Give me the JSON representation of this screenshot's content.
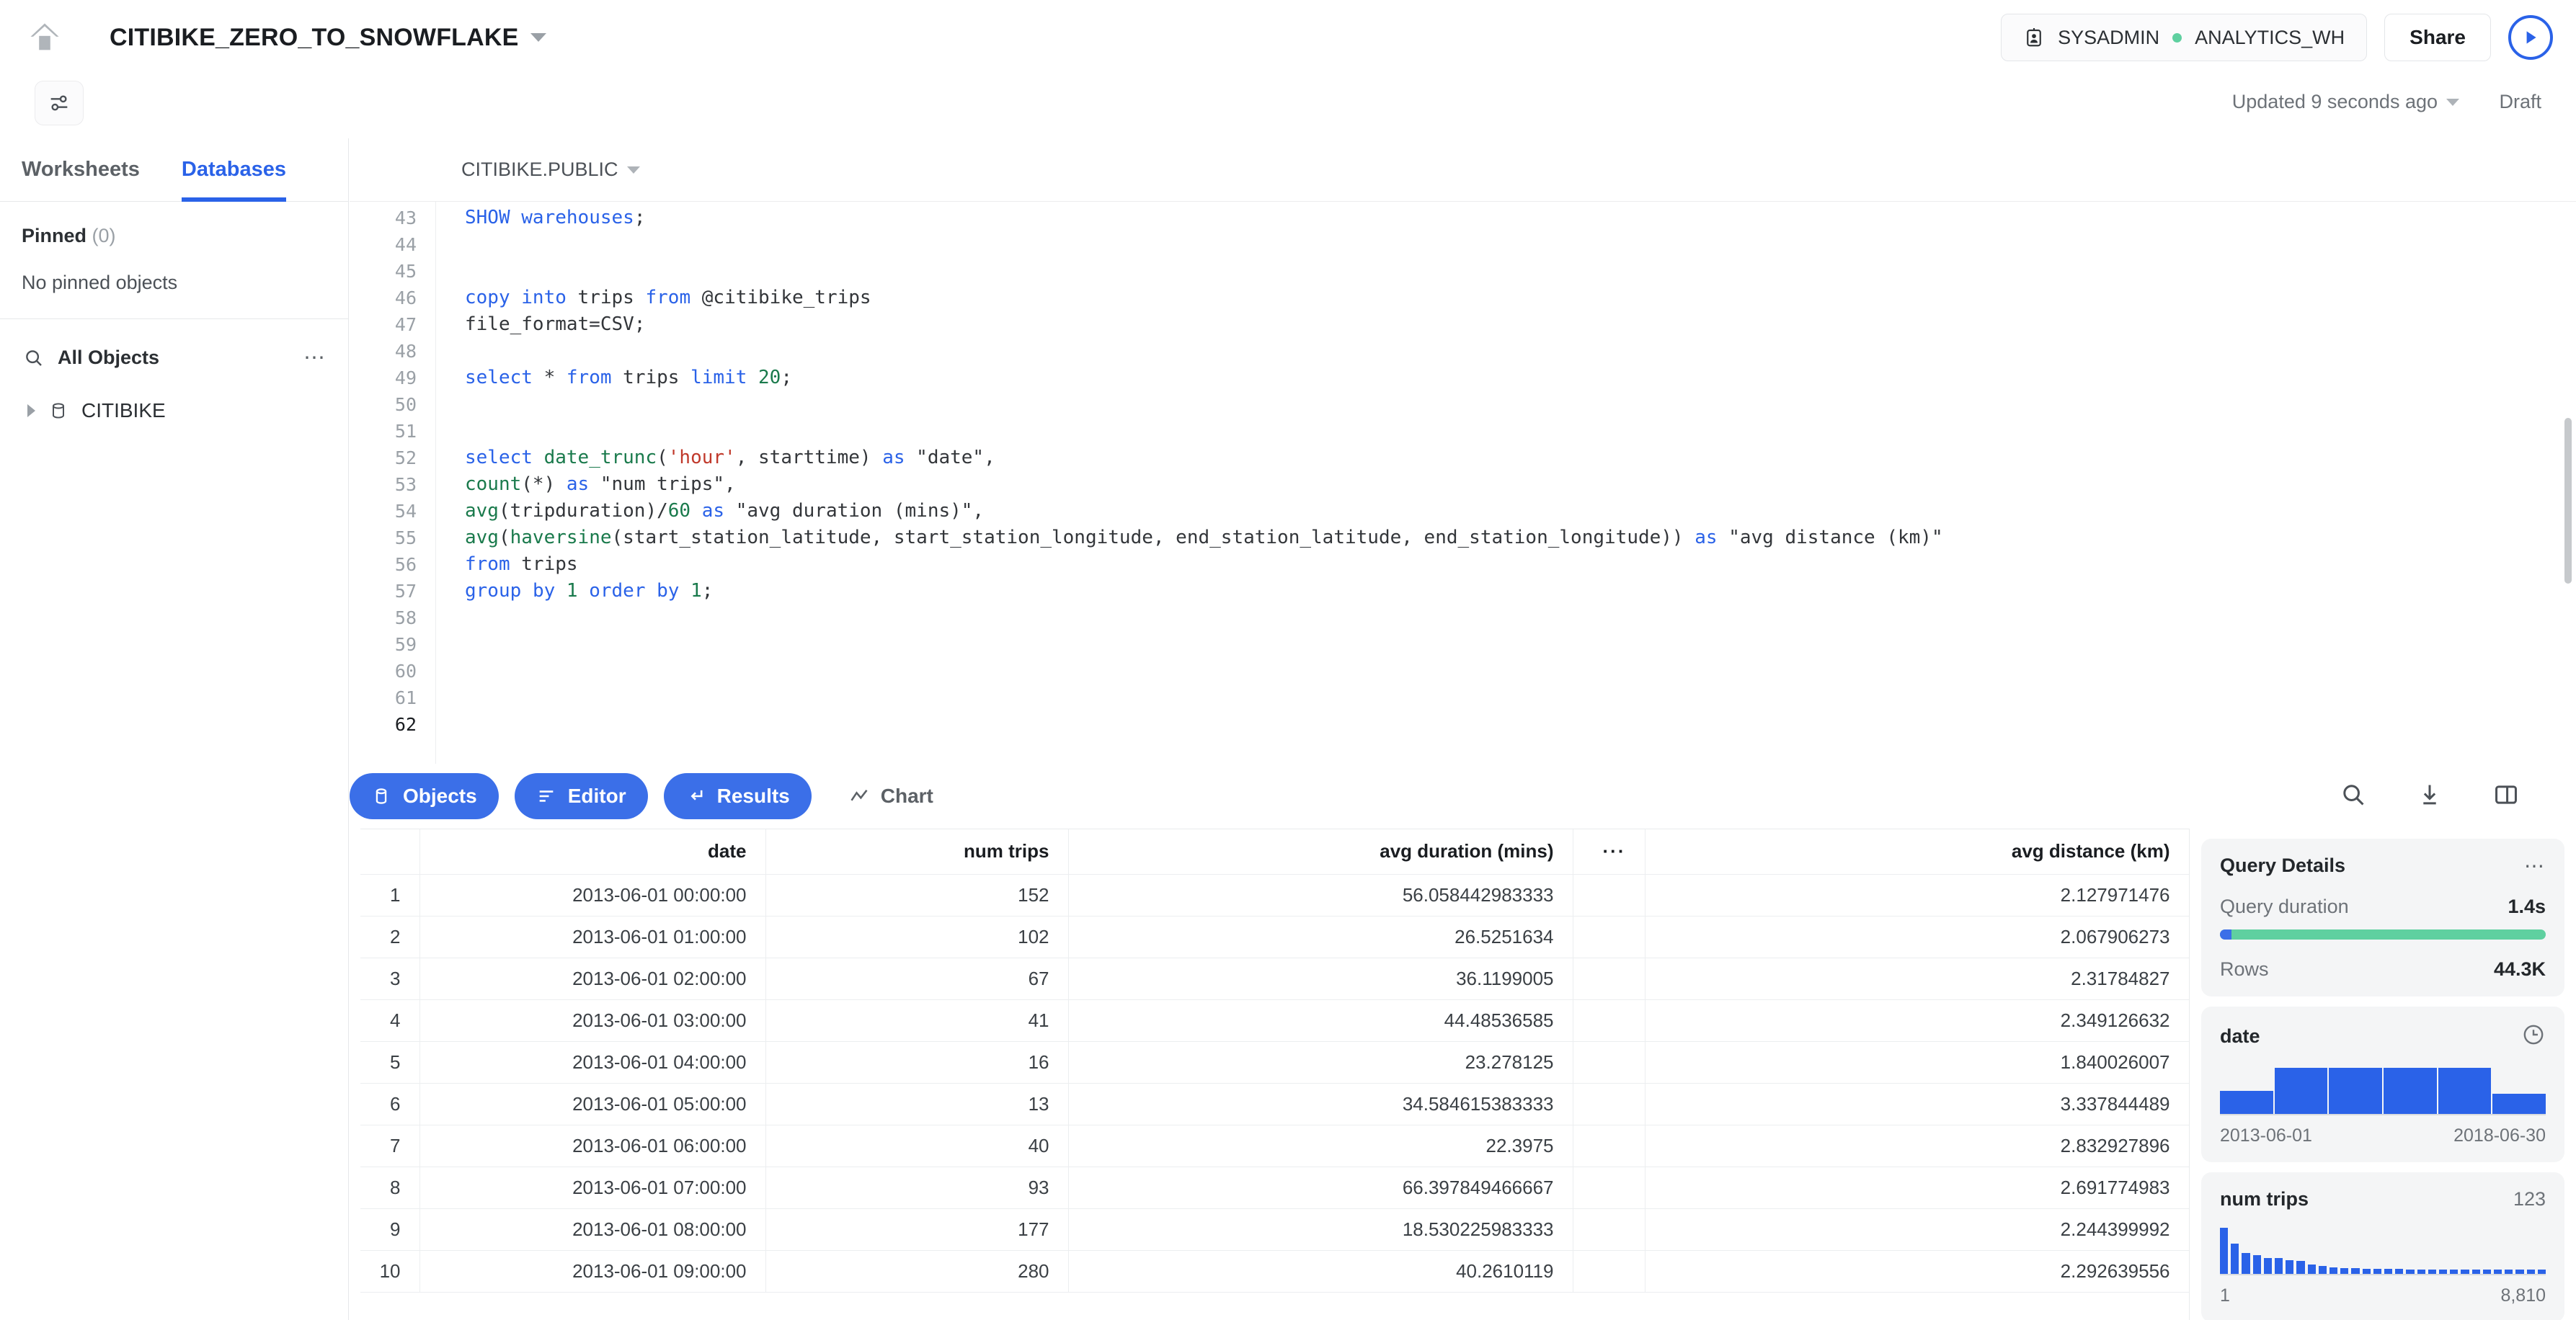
{
  "header": {
    "home_icon": "home-icon",
    "worksheet_title": "CITIBIKE_ZERO_TO_SNOWFLAKE",
    "role": "SYSADMIN",
    "warehouse": "ANALYTICS_WH",
    "share_label": "Share",
    "run_label": "run-query",
    "updated_text": "Updated 9 seconds ago",
    "draft_label": "Draft",
    "accent_blue": "#2a62e8",
    "status_green": "#5fd0a0"
  },
  "sidebar": {
    "tabs": [
      {
        "label": "Worksheets",
        "active": false
      },
      {
        "label": "Databases",
        "active": true
      }
    ],
    "pinned_label": "Pinned",
    "pinned_count": "(0)",
    "no_pinned_text": "No pinned objects",
    "all_objects_label": "All Objects",
    "databases": [
      {
        "name": "CITIBIKE"
      }
    ]
  },
  "editor": {
    "schema_selector": "CITIBIKE.PUBLIC",
    "first_line": 43,
    "last_line": 62,
    "lines": [
      {
        "n": 43,
        "html": "<span class=\"k\">SHOW</span> <span class=\"k\">warehouses</span>;"
      },
      {
        "n": 44,
        "html": ""
      },
      {
        "n": 45,
        "html": ""
      },
      {
        "n": 46,
        "html": "<span class=\"k\">copy</span> <span class=\"k\">into</span> trips <span class=\"k\">from</span> @citibike_trips"
      },
      {
        "n": 47,
        "html": "file_format=CSV;"
      },
      {
        "n": 48,
        "html": ""
      },
      {
        "n": 49,
        "html": "<span class=\"k\">select</span> * <span class=\"k\">from</span> trips <span class=\"k\">limit</span> <span class=\"num\">20</span>;"
      },
      {
        "n": 50,
        "html": ""
      },
      {
        "n": 51,
        "html": ""
      },
      {
        "n": 52,
        "html": "<span class=\"k\">select</span> <span class=\"fn\">date_trunc</span>(<span class=\"str\">'hour'</span>, starttime) <span class=\"k\">as</span> \"date\","
      },
      {
        "n": 53,
        "html": "<span class=\"fn\">count</span>(*) <span class=\"k\">as</span> \"num trips\","
      },
      {
        "n": 54,
        "html": "<span class=\"fn\">avg</span>(tripduration)/<span class=\"num\">60</span> <span class=\"k\">as</span> \"avg duration (mins)\","
      },
      {
        "n": 55,
        "html": "<span class=\"fn\">avg</span>(<span class=\"fn\">haversine</span>(start_station_latitude, start_station_longitude, end_station_latitude, end_station_longitude)) <span class=\"k\">as</span> \"avg distance (km)\""
      },
      {
        "n": 56,
        "html": "<span class=\"k\">from</span> trips"
      },
      {
        "n": 57,
        "html": "<span class=\"k\">group</span> <span class=\"k\">by</span> <span class=\"num\">1</span> <span class=\"k\">order</span> <span class=\"k\">by</span> <span class=\"num\">1</span>;"
      },
      {
        "n": 58,
        "html": ""
      },
      {
        "n": 59,
        "html": ""
      },
      {
        "n": 60,
        "html": ""
      },
      {
        "n": 61,
        "html": ""
      },
      {
        "n": 62,
        "html": ""
      }
    ],
    "plain_text": "SHOW warehouses;\n\n\ncopy into trips from @citibike_trips\nfile_format=CSV;\n\nselect * from trips limit 20;\n\n\nselect date_trunc('hour', starttime) as \"date\",\ncount(*) as \"num trips\",\navg(tripduration)/60 as \"avg duration (mins)\",\navg(haversine(start_station_latitude, start_station_longitude, end_station_latitude, end_station_longitude)) as \"avg distance (km)\"\nfrom trips\ngroup by 1 order by 1;"
  },
  "results_toolbar": {
    "tabs": [
      {
        "label": "Objects",
        "icon": "database-icon",
        "active": true
      },
      {
        "label": "Editor",
        "icon": "lines-icon",
        "active": true
      },
      {
        "label": "Results",
        "icon": "arrow-return-icon",
        "active": true
      },
      {
        "label": "Chart",
        "icon": "chart-line-icon",
        "active": false
      }
    ],
    "icons": [
      "search-icon",
      "download-icon",
      "split-panel-icon"
    ]
  },
  "results": {
    "columns": [
      "date",
      "num trips",
      "avg duration (mins)",
      "",
      "avg distance (km)"
    ],
    "overflow_marker": "···",
    "rows": [
      {
        "idx": "1",
        "date": "2013-06-01 00:00:00",
        "trips": "152",
        "dur": "56.058442983333",
        "dist": "2.127971476"
      },
      {
        "idx": "2",
        "date": "2013-06-01 01:00:00",
        "trips": "102",
        "dur": "26.5251634",
        "dist": "2.067906273"
      },
      {
        "idx": "3",
        "date": "2013-06-01 02:00:00",
        "trips": "67",
        "dur": "36.1199005",
        "dist": "2.31784827"
      },
      {
        "idx": "4",
        "date": "2013-06-01 03:00:00",
        "trips": "41",
        "dur": "44.48536585",
        "dist": "2.349126632"
      },
      {
        "idx": "5",
        "date": "2013-06-01 04:00:00",
        "trips": "16",
        "dur": "23.278125",
        "dist": "1.840026007"
      },
      {
        "idx": "6",
        "date": "2013-06-01 05:00:00",
        "trips": "13",
        "dur": "34.584615383333",
        "dist": "3.337844489"
      },
      {
        "idx": "7",
        "date": "2013-06-01 06:00:00",
        "trips": "40",
        "dur": "22.3975",
        "dist": "2.832927896"
      },
      {
        "idx": "8",
        "date": "2013-06-01 07:00:00",
        "trips": "93",
        "dur": "66.397849466667",
        "dist": "2.691774983"
      },
      {
        "idx": "9",
        "date": "2013-06-01 08:00:00",
        "trips": "177",
        "dur": "18.530225983333",
        "dist": "2.244399992"
      },
      {
        "idx": "10",
        "date": "2013-06-01 09:00:00",
        "trips": "280",
        "dur": "40.2610119",
        "dist": "2.292639556"
      }
    ]
  },
  "query_details": {
    "title": "Query Details",
    "duration_label": "Query duration",
    "duration_value": "1.4s",
    "rows_label": "Rows",
    "rows_value": "44.3K",
    "bar_blue_pct": 3.6,
    "bar_green_color": "#5fd0a0",
    "bar_blue_color": "#3b6fe8"
  },
  "chart_data": [
    {
      "type": "bar",
      "title": "date",
      "icon": "clock-icon",
      "categories": [
        "b1",
        "b2",
        "b3",
        "b4",
        "b5",
        "b6"
      ],
      "values": [
        34,
        68,
        68,
        68,
        68,
        30
      ],
      "ylim": [
        0,
        70
      ],
      "grid": false,
      "xlabel": "",
      "ylabel": "",
      "tick_labels": [
        "2013-06-01",
        "2018-06-30"
      ],
      "range_min": "2013-06-01",
      "range_max": "2018-06-30",
      "bar_color": "#2a62e8"
    },
    {
      "type": "bar",
      "title": "num trips",
      "value_label": "123",
      "categories": [
        "1",
        "2",
        "3",
        "4",
        "5",
        "6",
        "7",
        "8",
        "9",
        "10",
        "11",
        "12",
        "13",
        "14",
        "15",
        "16",
        "17",
        "18",
        "19",
        "20",
        "21",
        "22",
        "23",
        "24",
        "25",
        "26",
        "27",
        "28",
        "29",
        "30"
      ],
      "values": [
        58,
        38,
        26,
        24,
        20,
        20,
        17,
        16,
        12,
        10,
        8,
        7,
        7,
        6,
        6,
        6,
        6,
        5,
        5,
        5,
        5,
        5,
        5,
        5,
        5,
        5,
        5,
        5,
        5,
        5
      ],
      "ylim": [
        0,
        60
      ],
      "grid": false,
      "xlabel": "",
      "ylabel": "",
      "tick_labels": [
        "1",
        "8,810"
      ],
      "range_min": "1",
      "range_max": "8,810",
      "bar_color": "#2a62e8"
    }
  ]
}
